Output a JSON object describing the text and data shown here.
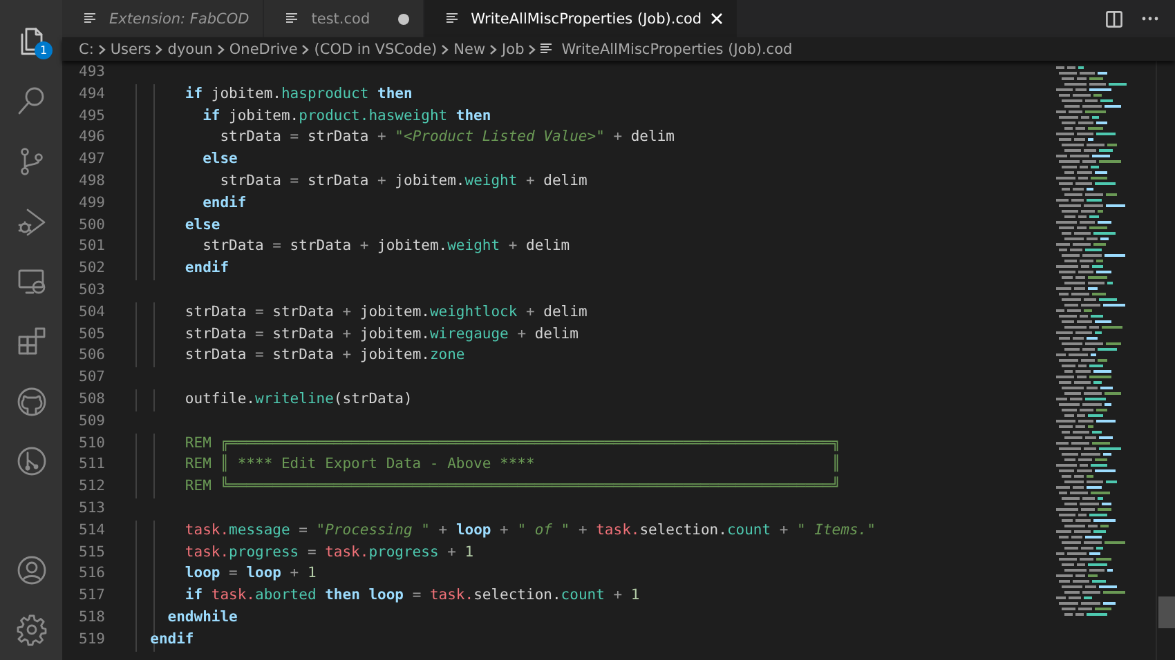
{
  "activity_bar": {
    "items": [
      {
        "kind": "explorer",
        "badge": "1"
      },
      {
        "kind": "search"
      },
      {
        "kind": "source-control"
      },
      {
        "kind": "run-debug"
      },
      {
        "kind": "remote"
      },
      {
        "kind": "extensions"
      },
      {
        "kind": "github"
      },
      {
        "kind": "graph"
      }
    ],
    "bottom_items": [
      {
        "kind": "account"
      },
      {
        "kind": "settings"
      }
    ]
  },
  "tabs": [
    {
      "label": "Extension: FabCOD",
      "selected": false,
      "preview": true,
      "modified": false
    },
    {
      "label": "test.cod",
      "selected": false,
      "preview": false,
      "modified": true
    },
    {
      "label": "WriteAllMiscProperties (Job).cod",
      "selected": true,
      "preview": false,
      "modified": false
    }
  ],
  "breadcrumbs": [
    "C:",
    "Users",
    "dyoun",
    "OneDrive",
    "(COD in VSCode)",
    "New",
    "Job",
    "WriteAllMiscProperties (Job).cod"
  ],
  "editor": {
    "lines": [
      {
        "number": "493"
      },
      {
        "number": "494",
        "tokens": [
          {
            "kind": "kw",
            "text": "      if"
          },
          {
            "kind": "id",
            "text": " jobitem."
          },
          {
            "kind": "prop",
            "text": "hasproduct"
          },
          {
            "kind": "kw",
            "text": " then"
          }
        ]
      },
      {
        "number": "495",
        "tokens": [
          {
            "kind": "kw",
            "text": "        if"
          },
          {
            "kind": "id",
            "text": " jobitem."
          },
          {
            "kind": "prop",
            "text": "product.hasweight"
          },
          {
            "kind": "kw",
            "text": " then"
          }
        ]
      },
      {
        "number": "496",
        "tokens": [
          {
            "kind": "id",
            "text": "          strData"
          },
          {
            "kind": "op",
            "text": " = "
          },
          {
            "kind": "id",
            "text": "strData"
          },
          {
            "kind": "op",
            "text": " + "
          },
          {
            "kind": "str",
            "text": "\"<Product Listed Value>\""
          },
          {
            "kind": "op",
            "text": " + "
          },
          {
            "kind": "id",
            "text": "delim"
          }
        ]
      },
      {
        "number": "497",
        "tokens": [
          {
            "kind": "kw",
            "text": "        else"
          }
        ]
      },
      {
        "number": "498",
        "tokens": [
          {
            "kind": "id",
            "text": "          strData"
          },
          {
            "kind": "op",
            "text": " = "
          },
          {
            "kind": "id",
            "text": "strData"
          },
          {
            "kind": "op",
            "text": " + "
          },
          {
            "kind": "id",
            "text": "jobitem."
          },
          {
            "kind": "prop",
            "text": "weight"
          },
          {
            "kind": "op",
            "text": " + "
          },
          {
            "kind": "id",
            "text": "delim"
          }
        ]
      },
      {
        "number": "499",
        "tokens": [
          {
            "kind": "kw",
            "text": "        endif"
          }
        ]
      },
      {
        "number": "500",
        "tokens": [
          {
            "kind": "kw",
            "text": "      else"
          }
        ]
      },
      {
        "number": "501",
        "tokens": [
          {
            "kind": "id",
            "text": "        strData"
          },
          {
            "kind": "op",
            "text": " = "
          },
          {
            "kind": "id",
            "text": "strData"
          },
          {
            "kind": "op",
            "text": " + "
          },
          {
            "kind": "id",
            "text": "jobitem."
          },
          {
            "kind": "prop",
            "text": "weight"
          },
          {
            "kind": "op",
            "text": " + "
          },
          {
            "kind": "id",
            "text": "delim"
          }
        ]
      },
      {
        "number": "502",
        "tokens": [
          {
            "kind": "kw",
            "text": "      endif"
          }
        ]
      },
      {
        "number": "503"
      },
      {
        "number": "504",
        "tokens": [
          {
            "kind": "id",
            "text": "      strData"
          },
          {
            "kind": "op",
            "text": " = "
          },
          {
            "kind": "id",
            "text": "strData"
          },
          {
            "kind": "op",
            "text": " + "
          },
          {
            "kind": "id",
            "text": "jobitem."
          },
          {
            "kind": "prop",
            "text": "weightlock"
          },
          {
            "kind": "op",
            "text": " + "
          },
          {
            "kind": "id",
            "text": "delim"
          }
        ]
      },
      {
        "number": "505",
        "tokens": [
          {
            "kind": "id",
            "text": "      strData"
          },
          {
            "kind": "op",
            "text": " = "
          },
          {
            "kind": "id",
            "text": "strData"
          },
          {
            "kind": "op",
            "text": " + "
          },
          {
            "kind": "id",
            "text": "jobitem."
          },
          {
            "kind": "prop",
            "text": "wiregauge"
          },
          {
            "kind": "op",
            "text": " + "
          },
          {
            "kind": "id",
            "text": "delim"
          }
        ]
      },
      {
        "number": "506",
        "tokens": [
          {
            "kind": "id",
            "text": "      strData"
          },
          {
            "kind": "op",
            "text": " = "
          },
          {
            "kind": "id",
            "text": "strData"
          },
          {
            "kind": "op",
            "text": " + "
          },
          {
            "kind": "id",
            "text": "jobitem."
          },
          {
            "kind": "prop",
            "text": "zone"
          }
        ]
      },
      {
        "number": "507"
      },
      {
        "number": "508",
        "tokens": [
          {
            "kind": "id",
            "text": "      outfile."
          },
          {
            "kind": "prop",
            "text": "writeline"
          },
          {
            "kind": "id",
            "text": "(strData)"
          }
        ]
      },
      {
        "number": "509"
      },
      {
        "number": "510",
        "tokens": [
          {
            "kind": "comment",
            "text": "      REM ╔═════════════════════════════════════════════════════════════════════╗"
          }
        ]
      },
      {
        "number": "511",
        "tokens": [
          {
            "kind": "comment",
            "text": "      REM ║ **** Edit Export Data - Above ****                                  ║"
          }
        ]
      },
      {
        "number": "512",
        "tokens": [
          {
            "kind": "comment",
            "text": "      REM ╚═════════════════════════════════════════════════════════════════════╝"
          }
        ]
      },
      {
        "number": "513"
      },
      {
        "number": "514",
        "tokens": [
          {
            "kind": "obj",
            "text": "      task."
          },
          {
            "kind": "prop",
            "text": "message"
          },
          {
            "kind": "op",
            "text": " = "
          },
          {
            "kind": "str",
            "text": "\"Processing \""
          },
          {
            "kind": "op",
            "text": " + "
          },
          {
            "kind": "kw",
            "text": "loop"
          },
          {
            "kind": "op",
            "text": " + "
          },
          {
            "kind": "str",
            "text": "\" of \""
          },
          {
            "kind": "op",
            "text": " + "
          },
          {
            "kind": "obj",
            "text": "task."
          },
          {
            "kind": "id",
            "text": "selection."
          },
          {
            "kind": "prop",
            "text": "count"
          },
          {
            "kind": "op",
            "text": " + "
          },
          {
            "kind": "str",
            "text": "\" Items.\""
          }
        ]
      },
      {
        "number": "515",
        "tokens": [
          {
            "kind": "obj",
            "text": "      task."
          },
          {
            "kind": "prop",
            "text": "progress"
          },
          {
            "kind": "op",
            "text": " = "
          },
          {
            "kind": "obj",
            "text": "task."
          },
          {
            "kind": "prop",
            "text": "progress"
          },
          {
            "kind": "op",
            "text": " + "
          },
          {
            "kind": "num",
            "text": "1"
          }
        ]
      },
      {
        "number": "516",
        "tokens": [
          {
            "kind": "kw",
            "text": "      loop"
          },
          {
            "kind": "op",
            "text": " = "
          },
          {
            "kind": "kw",
            "text": "loop"
          },
          {
            "kind": "op",
            "text": " + "
          },
          {
            "kind": "num",
            "text": "1"
          }
        ]
      },
      {
        "number": "517",
        "tokens": [
          {
            "kind": "kw",
            "text": "      if"
          },
          {
            "kind": "obj",
            "text": " task."
          },
          {
            "kind": "prop",
            "text": "aborted"
          },
          {
            "kind": "kw",
            "text": " then loop"
          },
          {
            "kind": "op",
            "text": " = "
          },
          {
            "kind": "obj",
            "text": "task."
          },
          {
            "kind": "id",
            "text": "selection."
          },
          {
            "kind": "prop",
            "text": "count"
          },
          {
            "kind": "op",
            "text": " + "
          },
          {
            "kind": "num",
            "text": "1"
          }
        ]
      },
      {
        "number": "518",
        "tokens": [
          {
            "kind": "kw",
            "text": "    endwhile"
          }
        ]
      },
      {
        "number": "519",
        "tokens": [
          {
            "kind": "kw",
            "text": "  endif"
          }
        ]
      }
    ]
  }
}
